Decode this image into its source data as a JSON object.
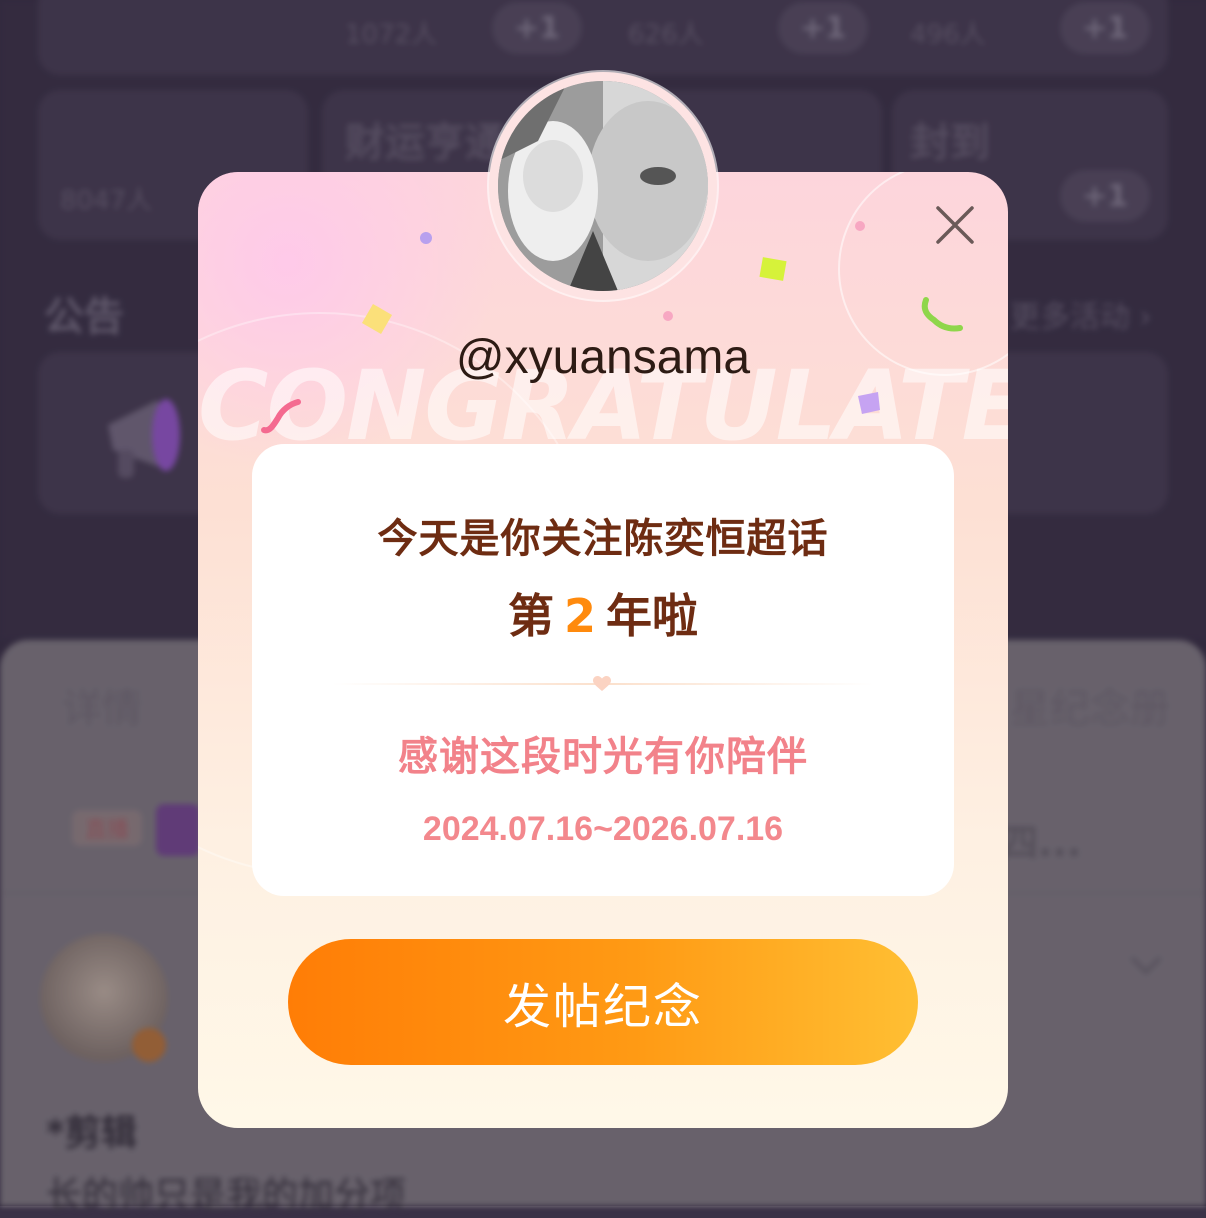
{
  "background": {
    "stats_row": [
      "1072人",
      "+1",
      "626人",
      "+1",
      "496人",
      "+1"
    ],
    "left_count": "8047人",
    "middle_title": "财运亨通",
    "right_title": "封到",
    "right_plus": "+1",
    "announcement_title": "公告",
    "more_activities": "更多活动 ›",
    "tab_details": "详情",
    "tab_album": "星纪念册",
    "tag_badge": "直播",
    "row_tail": "四...",
    "post_author_label": "*剪辑",
    "post_text": "长的帅只是我的加分项"
  },
  "modal": {
    "watermark": "CONGRATULATE",
    "username": "@xyuansama",
    "line1": "今天是你关注陈奕恒超话",
    "line2_prefix": "第",
    "years": "2",
    "line2_suffix": "年啦",
    "thanks": "感谢这段时光有你陪伴",
    "date_range": "2024.07.16~2026.07.16",
    "post_button": "发帖纪念"
  },
  "colors": {
    "accent_orange": "#ff8a0d",
    "title_brown": "#6e2c12",
    "pink_text": "#f2828a"
  },
  "icons": [
    "close-icon",
    "heart-icon",
    "megaphone-icon",
    "chevron-down-icon",
    "verified-icon"
  ]
}
